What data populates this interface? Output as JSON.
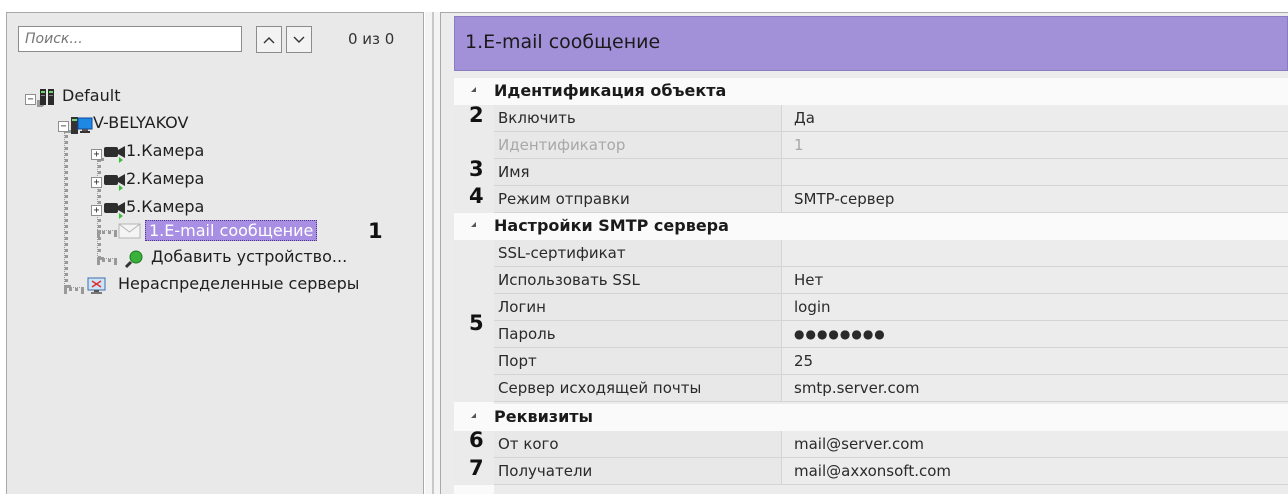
{
  "search": {
    "placeholder": "Поиск...",
    "counter": "0 из 0"
  },
  "tree": {
    "root_label": "Default",
    "server_label": "V-BELYAKOV",
    "cameras": [
      "1.Камера",
      "2.Камера",
      "5.Камера"
    ],
    "email_label": "1.E-mail сообщение",
    "add_device_label": "Добавить устройство...",
    "unassigned_label": "Нераспределенные серверы",
    "expand_symbol": "+",
    "collapse_symbol": "−"
  },
  "callouts": {
    "c1": "1",
    "c2": "2",
    "c3": "3",
    "c4": "4",
    "c5": "5",
    "c6": "6",
    "c7": "7"
  },
  "panel": {
    "title": "1.E-mail сообщение"
  },
  "sections": {
    "identification": {
      "title": "Идентификация объекта",
      "props": [
        {
          "name": "Включить",
          "value": "Да"
        },
        {
          "name": "Идентификатор",
          "value": "1"
        },
        {
          "name": "Имя",
          "value": ""
        },
        {
          "name": "Режим отправки",
          "value": "SMTP-сервер"
        }
      ]
    },
    "smtp": {
      "title": "Настройки SMTP сервера",
      "props": [
        {
          "name": "SSL-сертификат",
          "value": ""
        },
        {
          "name": "Использовать SSL",
          "value": "Нет"
        },
        {
          "name": "Логин",
          "value": "login"
        },
        {
          "name": "Пароль",
          "value": "●●●●●●●●"
        },
        {
          "name": "Порт",
          "value": "25"
        },
        {
          "name": "Сервер исходящей почты",
          "value": "smtp.server.com"
        }
      ]
    },
    "requisites": {
      "title": "Реквизиты",
      "props": [
        {
          "name": "От кого",
          "value": "mail@server.com"
        },
        {
          "name": "Получатели",
          "value": "mail@axxonsoft.com"
        }
      ]
    }
  },
  "colors": {
    "header_bg": "#a290d8",
    "selection_bg": "#a98fe3"
  }
}
